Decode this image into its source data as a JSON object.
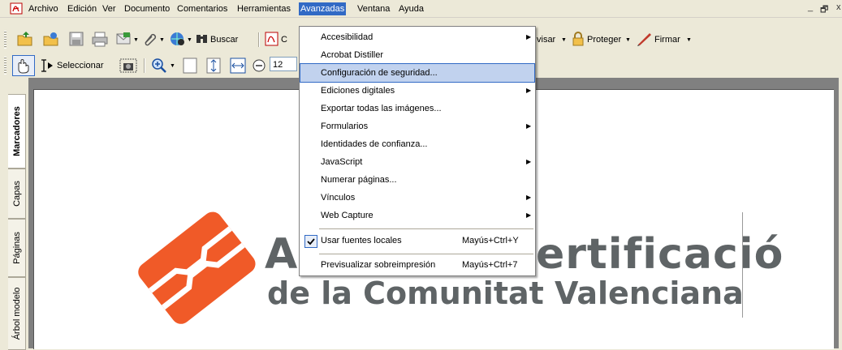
{
  "menubar": {
    "items": [
      "Archivo",
      "Edición",
      "Ver",
      "Documento",
      "Comentarios",
      "Herramientas",
      "Avanzadas",
      "Ventana",
      "Ayuda"
    ],
    "window_controls": [
      "_",
      "🗗",
      "x"
    ]
  },
  "toolbar1": {
    "search_label": "Buscar",
    "create_label_partial": "C",
    "review_label": "visar",
    "protect_label": "Proteger",
    "sign_label": "Firmar"
  },
  "toolbar2": {
    "select_label": "Seleccionar",
    "zoom_value_partial": "12"
  },
  "left_tabs": [
    "Marcadores",
    "Capas",
    "Páginas",
    "Árbol modelo"
  ],
  "document": {
    "logo_line1_a": "A",
    "logo_line1_b": "ertificació",
    "logo_line2": "de la Comunitat Valenciana"
  },
  "dropdown": {
    "items": [
      {
        "label": "Accesibilidad",
        "submenu": true
      },
      {
        "label": "Acrobat Distiller",
        "submenu": false
      },
      {
        "label": "Configuración de seguridad...",
        "submenu": false,
        "highlighted": true
      },
      {
        "label": "Ediciones digitales",
        "submenu": true
      },
      {
        "label": "Exportar todas las imágenes...",
        "submenu": false
      },
      {
        "label": "Formularios",
        "submenu": true
      },
      {
        "label": "Identidades de confianza...",
        "submenu": false
      },
      {
        "label": "JavaScript",
        "submenu": true
      },
      {
        "label": "Numerar páginas...",
        "submenu": false
      },
      {
        "label": "Vínculos",
        "submenu": true
      },
      {
        "label": "Web Capture",
        "submenu": true
      },
      {
        "label": "Usar fuentes locales",
        "shortcut": "Mayús+Ctrl+Y",
        "checked": true
      },
      {
        "label": "Previsualizar sobreimpresión",
        "shortcut": "Mayús+Ctrl+7"
      }
    ]
  },
  "colors": {
    "menu_highlight": "#316ac5",
    "item_highlight": "#c1d2ee",
    "logo_orange": "#f05a28",
    "logo_gray": "#5f6466"
  }
}
